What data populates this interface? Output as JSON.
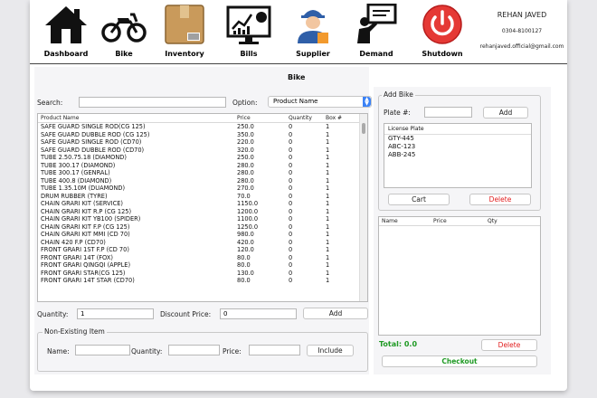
{
  "nav": [
    {
      "label": "Dashboard",
      "icon": "house-icon"
    },
    {
      "label": "Bike",
      "icon": "motorcycle-icon"
    },
    {
      "label": "Inventory",
      "icon": "box-icon"
    },
    {
      "label": "Bills",
      "icon": "chart-monitor-icon"
    },
    {
      "label": "Supplier",
      "icon": "worker-icon"
    },
    {
      "label": "Demand",
      "icon": "presenter-icon"
    },
    {
      "label": "Shutdown",
      "icon": "power-icon"
    }
  ],
  "user": {
    "name": "REHAN JAVED",
    "phone": "0304-8100127",
    "email": "rehanjaved.official@gmail.com"
  },
  "page_title": "Bike",
  "search": {
    "label": "Search:",
    "value": "",
    "option_label": "Option:",
    "option_value": "Product Name"
  },
  "product_table": {
    "columns": [
      "Product Name",
      "Price",
      "Quantity",
      "Box #"
    ],
    "rows": [
      [
        "SAFE GUARD SINGLE ROD(CG 125)",
        "250.0",
        "0",
        "1"
      ],
      [
        "SAFE GUARD DUBBLE ROD   (CG 125)",
        "350.0",
        "0",
        "1"
      ],
      [
        "SAFE GUARD SINGLE ROD (CD70)",
        "220.0",
        "0",
        "1"
      ],
      [
        "SAFE GUARD DUBBLE ROD (CD70)",
        "320.0",
        "0",
        "1"
      ],
      [
        "TUBE 2.50.75.18  (DIAMOND)",
        "250.0",
        "0",
        "1"
      ],
      [
        "TUBE 300.17 (DIAMOND)",
        "280.0",
        "0",
        "1"
      ],
      [
        "TUBE 300.17 (GENRAL)",
        "280.0",
        "0",
        "1"
      ],
      [
        "TUBE 400.8 (DIAMOND)",
        "280.0",
        "0",
        "1"
      ],
      [
        "TUBE 1.35.10M (DUAMOND)",
        "270.0",
        "0",
        "1"
      ],
      [
        "DRUM RUBBER  (TYRE)",
        "70.0",
        "0",
        "1"
      ],
      [
        "CHAIN GRARI KIT (SERVICE)",
        "1150.0",
        "0",
        "1"
      ],
      [
        "CHAIN GRARI KIT R.P (CG 125)",
        "1200.0",
        "0",
        "1"
      ],
      [
        "CHAIN GRARI KIT YB100 (SPIDER)",
        "1100.0",
        "0",
        "1"
      ],
      [
        "CHAIN GRARI KIT F.P (CG 125)",
        "1250.0",
        "0",
        "1"
      ],
      [
        "CHAIN GRARI KIT MMI (CD 70)",
        "980.0",
        "0",
        "1"
      ],
      [
        "CHAIN 420  F.P (CD70)",
        "420.0",
        "0",
        "1"
      ],
      [
        "FRONT GRARI 1ST F.P (CD 70)",
        "120.0",
        "0",
        "1"
      ],
      [
        "FRONT GRARI 14T (FOX)",
        "80.0",
        "0",
        "1"
      ],
      [
        "FRONT GRARI QINGQI (APPLE)",
        "80.0",
        "0",
        "1"
      ],
      [
        "FRONT GRARI STAR(CG 125)",
        "130.0",
        "0",
        "1"
      ],
      [
        "FRONT GRARI 14T  STAR (CD70)",
        "80.0",
        "0",
        "1"
      ]
    ]
  },
  "quantity": {
    "label": "Quantity:",
    "value": "1",
    "discount_label": "Discount Price:",
    "discount_value": "0",
    "add_label": "Add"
  },
  "non_existing": {
    "title": "Non-Existing Item",
    "name_label": "Name:",
    "qty_label": "Quantity:",
    "price_label": "Price:",
    "include_label": "Include"
  },
  "add_bike": {
    "title": "Add Bike",
    "plate_label": "Plate #:",
    "plate_value": "",
    "add_label": "Add",
    "list_header": "License Plate",
    "plates": [
      "GTY-445",
      "ABC-123",
      "ABB-245"
    ],
    "cart_label": "Cart",
    "delete_label": "Delete"
  },
  "cart_table": {
    "columns": [
      "Name",
      "Price",
      "Qty"
    ]
  },
  "total": {
    "text": "Total: 0.0",
    "delete_label": "Delete",
    "checkout_label": "Checkout"
  },
  "colors": {
    "red": "#e11d1d",
    "green": "#1f9a24",
    "accent": "#3b82f6"
  }
}
